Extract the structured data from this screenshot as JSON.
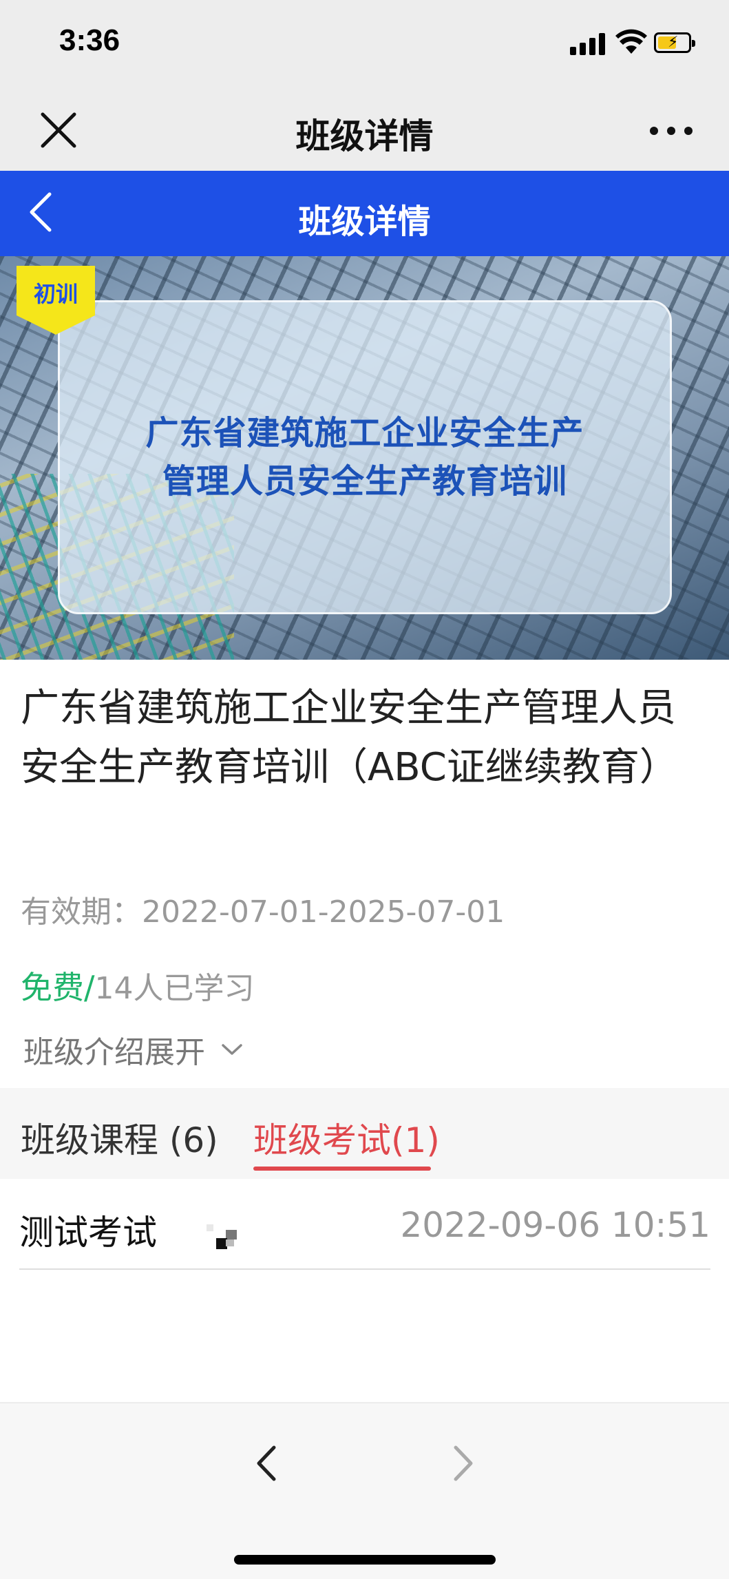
{
  "status_bar": {
    "time": "3:36"
  },
  "wechat_bar": {
    "title": "班级详情",
    "close_icon": "close-icon",
    "more_icon": "more-icon"
  },
  "app_header": {
    "title": "班级详情",
    "back_icon": "back-icon",
    "color": "#1e50e6"
  },
  "banner": {
    "tag": "初训",
    "line1": "广东省建筑施工企业安全生产",
    "line2": "管理人员安全生产教育培训",
    "tag_color": "#f5e61a"
  },
  "course": {
    "title": "广东省建筑施工企业安全生产管理人员安全生产教育培训（ABC证继续教育）",
    "validity": "有效期：2022-07-01-2025-07-01",
    "price": "免费/",
    "learners": "14人已学习",
    "intro_toggle": "班级介绍展开",
    "free_color": "#20b46b"
  },
  "tabs": {
    "course_tab": "班级课程 (6)",
    "exam_tab": "班级考试(1)",
    "active_color": "#e0484d"
  },
  "exams": [
    {
      "name": "测试考试",
      "time": "2022-09-06 10:51"
    }
  ],
  "bottom_bar": {
    "back_icon": "chevron-left-icon",
    "forward_icon": "chevron-right-icon"
  }
}
